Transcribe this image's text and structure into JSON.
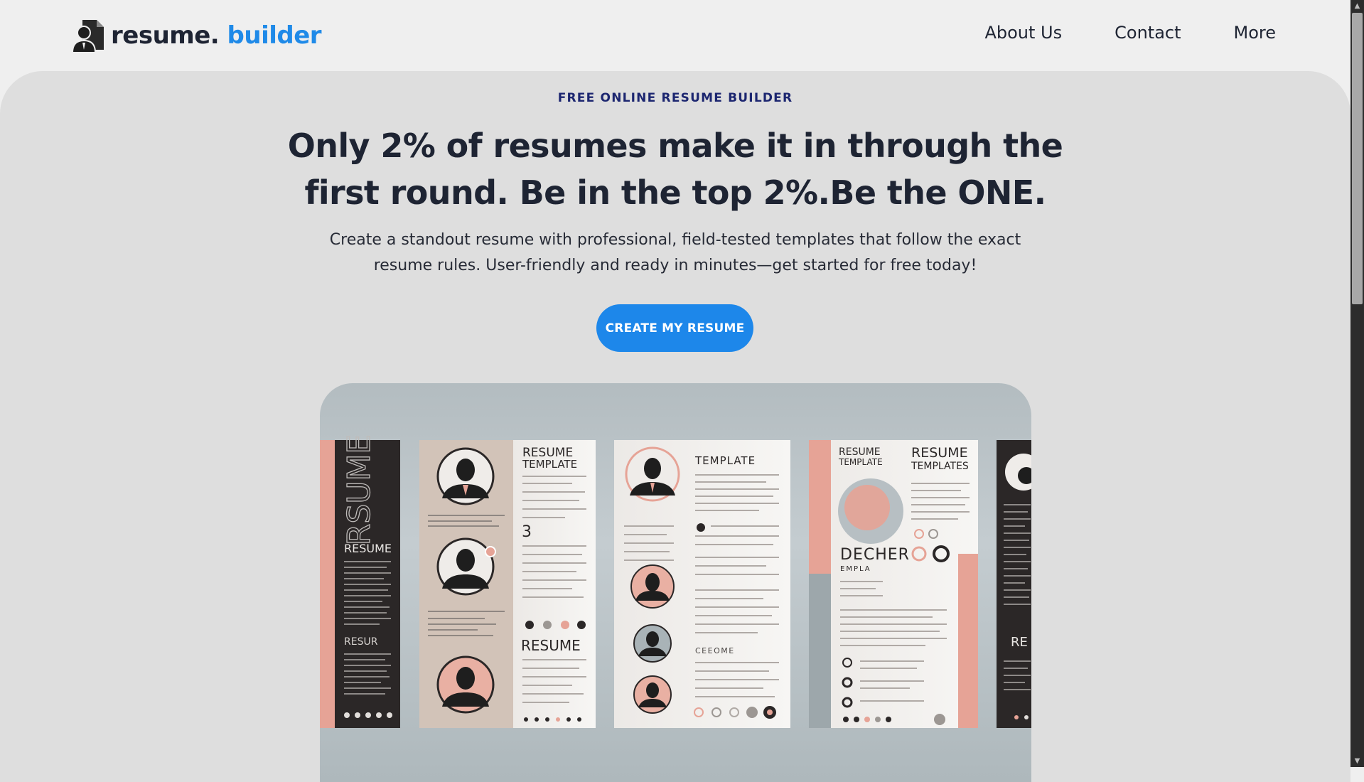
{
  "header": {
    "logo": {
      "text_main": "resume.",
      "text_accent": "builder",
      "icon": "resume-person-icon"
    },
    "nav": [
      {
        "label": "About Us"
      },
      {
        "label": "Contact"
      },
      {
        "label": "More"
      }
    ]
  },
  "hero": {
    "eyebrow": "FREE ONLINE RESUME BUILDER",
    "headline_line1": "Only 2% of resumes make it in through the",
    "headline_line2": "first round. Be in the top 2%.Be the ONE.",
    "subtext_line1": "Create a standout resume with professional, field-tested templates that follow the exact",
    "subtext_line2": "resume rules. User-friendly and ready in minutes—get started for free today!",
    "cta_label": "CREATE MY RESUME"
  },
  "showcase": {
    "cards": [
      {
        "texts": [
          "RSUME",
          "RESUME",
          "RESUR"
        ]
      },
      {
        "texts": [
          "RESUME",
          "TEMPLATE",
          "3",
          "RESUME"
        ]
      },
      {
        "texts": [
          "TEMPLATE",
          "CEEOME"
        ]
      },
      {
        "texts": [
          "RESUME",
          "TEMPLATE",
          "RESUME",
          "TEMPLATES",
          "DECHER",
          "EMPLA"
        ]
      },
      {
        "texts": [
          "RE"
        ]
      }
    ]
  },
  "scrollbar": {
    "up_icon": "chevron-up-icon",
    "down_icon": "chevron-down-icon",
    "thumb_position": 0,
    "thumb_fraction": 0.39
  },
  "colors": {
    "accent": "#1f8ae8",
    "cta_bg": "#1d87ea",
    "eyebrow": "#1c2670",
    "text_dark": "#1e2433",
    "page_bg": "#efefef",
    "hero_bg": "#dedede",
    "resume_pink": "#e6a396",
    "resume_dark": "#2b2727"
  }
}
